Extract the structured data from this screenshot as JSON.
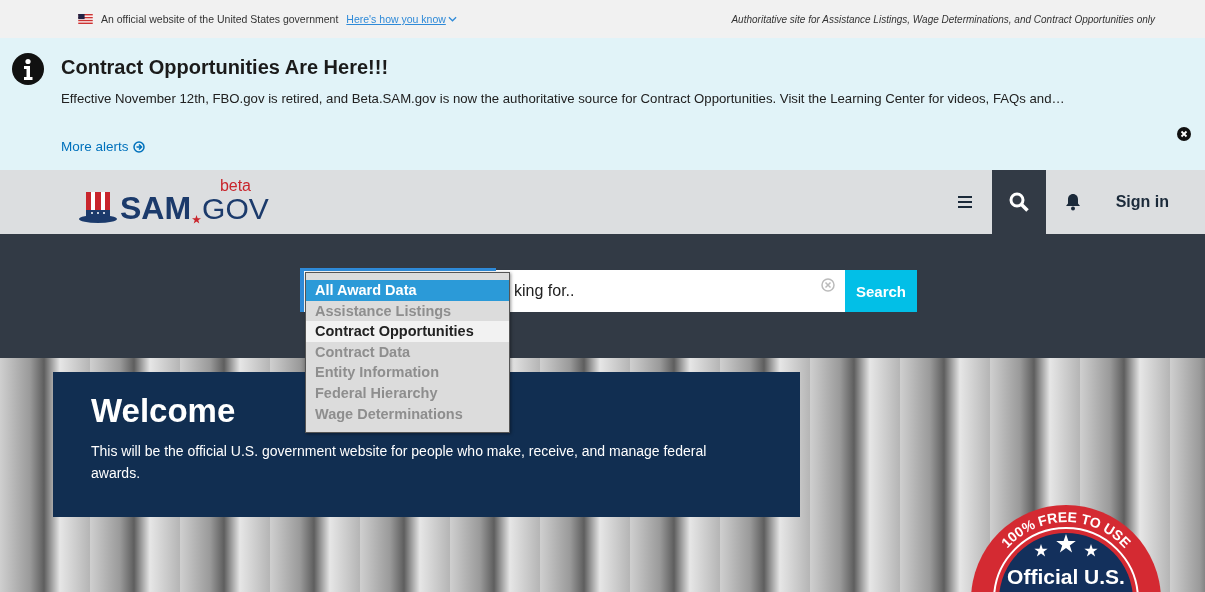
{
  "gov_banner": {
    "text": "An official website of the United States government",
    "link": "Here's how you know",
    "tagline": "Authoritative site for Assistance Listings, Wage Determinations, and Contract Opportunities only"
  },
  "alert": {
    "title": "Contract Opportunities Are Here!!!",
    "body": "Effective November 12th, FBO.gov is retired, and Beta.SAM.gov is now the authoritative source for Contract Opportunities. Visit the Learning Center for videos, FAQs and…",
    "more_link": "More alerts"
  },
  "header": {
    "logo": {
      "name": "SAM",
      "domain": "GOV",
      "badge": "beta"
    },
    "sign_in": "Sign in"
  },
  "search": {
    "placeholder": "king for..",
    "button": "Search",
    "domain_options": [
      {
        "label": "All Award Data",
        "selected": true,
        "hovered": false,
        "disabled": false
      },
      {
        "label": "Assistance Listings",
        "selected": false,
        "hovered": false,
        "disabled": true
      },
      {
        "label": "Contract Opportunities",
        "selected": false,
        "hovered": true,
        "disabled": false
      },
      {
        "label": "Contract Data",
        "selected": false,
        "hovered": false,
        "disabled": true
      },
      {
        "label": "Entity Information",
        "selected": false,
        "hovered": false,
        "disabled": true
      },
      {
        "label": "Federal Hierarchy",
        "selected": false,
        "hovered": false,
        "disabled": true
      },
      {
        "label": "Wage Determinations",
        "selected": false,
        "hovered": false,
        "disabled": true
      }
    ]
  },
  "welcome": {
    "title": "Welcome",
    "text": "This will be the official U.S. government website for people who make, receive, and manage federal awards."
  },
  "seal": {
    "arc_text": "100% FREE TO USE",
    "text": "Official U.S."
  }
}
